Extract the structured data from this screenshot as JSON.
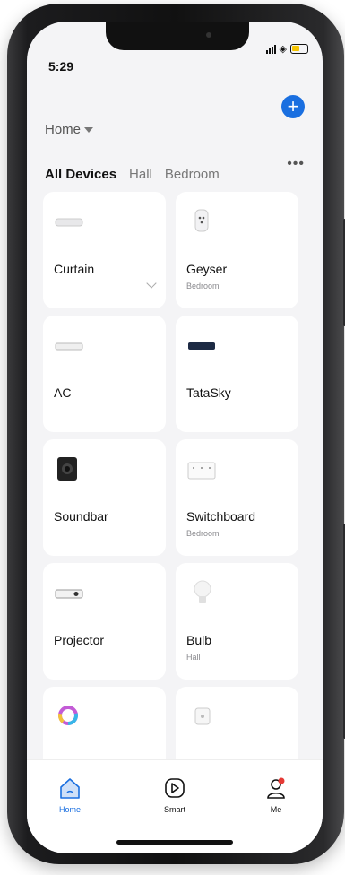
{
  "status": {
    "time": "5:29"
  },
  "header": {
    "home_label": "Home"
  },
  "tabs": [
    {
      "label": "All Devices"
    },
    {
      "label": "Hall"
    },
    {
      "label": "Bedroom"
    }
  ],
  "devices": [
    {
      "name": "Curtain",
      "room": "",
      "icon": "curtain-icon"
    },
    {
      "name": "Geyser",
      "room": "Bedroom",
      "icon": "smart-plug-icon"
    },
    {
      "name": "AC",
      "room": "",
      "icon": "air-conditioner-icon"
    },
    {
      "name": "TataSky",
      "room": "",
      "icon": "set-top-box-icon"
    },
    {
      "name": "Soundbar",
      "room": "",
      "icon": "speaker-icon"
    },
    {
      "name": "Switchboard",
      "room": "Bedroom",
      "icon": "switchboard-icon"
    },
    {
      "name": "Projector",
      "room": "",
      "icon": "projector-icon"
    },
    {
      "name": "Bulb",
      "room": "Hall",
      "icon": "bulb-icon"
    },
    {
      "name": "",
      "room": "",
      "icon": "rgb-light-icon"
    },
    {
      "name": "",
      "room": "",
      "icon": "switch-icon"
    }
  ],
  "tabbar": [
    {
      "label": "Home",
      "icon": "home-icon",
      "color": "#1a6fe0"
    },
    {
      "label": "Smart",
      "icon": "smart-icon",
      "color": "#111111"
    },
    {
      "label": "Me",
      "icon": "user-icon",
      "color": "#111111"
    }
  ],
  "colors": {
    "accent": "#1a6fe0",
    "notification": "#e53935"
  }
}
